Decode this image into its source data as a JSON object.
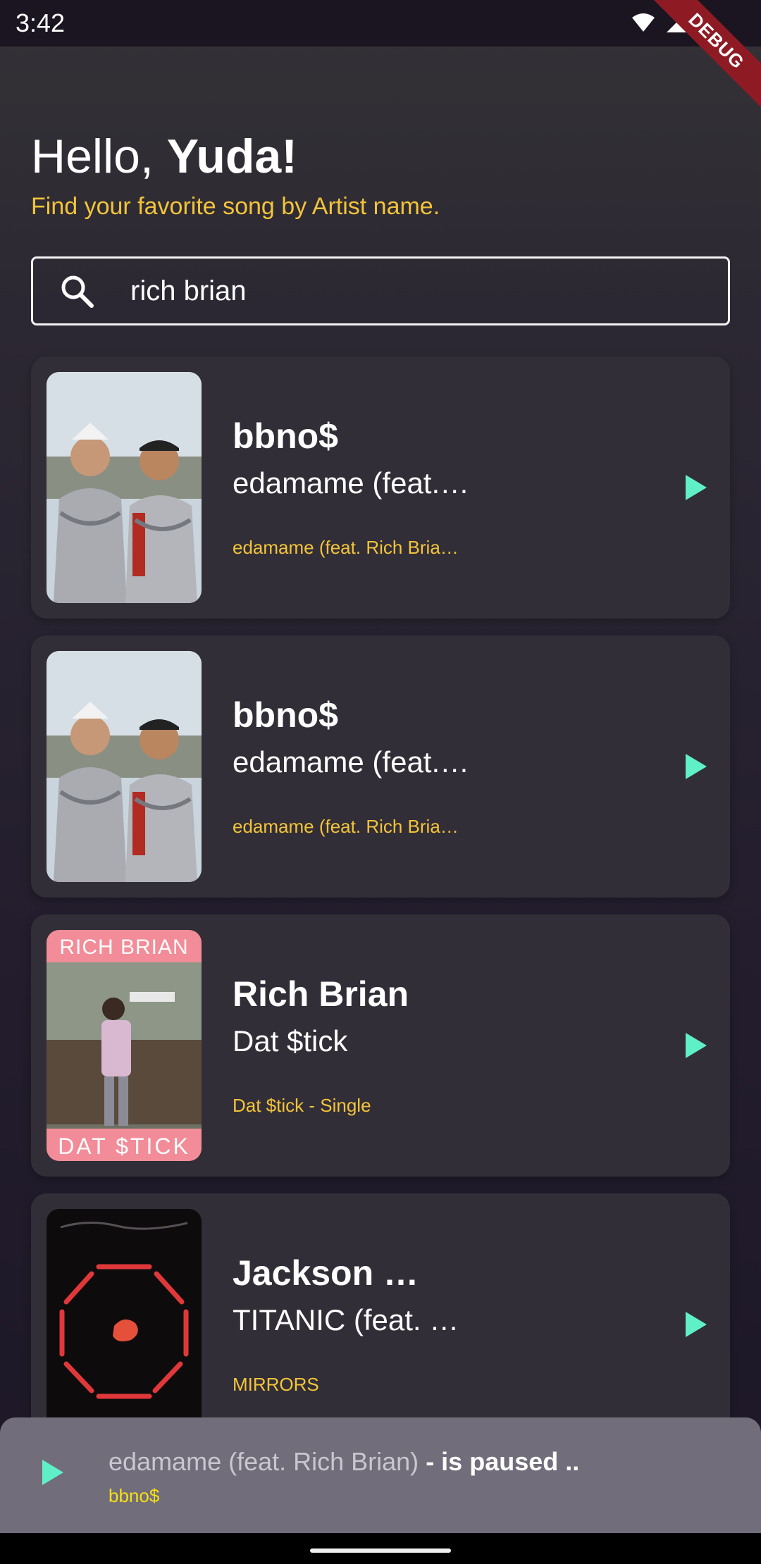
{
  "status_bar": {
    "time": "3:42",
    "icons": [
      "wifi-icon",
      "cell-signal-icon",
      "battery-icon"
    ],
    "debug_label": "DEBUG"
  },
  "header": {
    "greeting_prefix": "Hello, ",
    "user_name": "Yuda!",
    "subtitle": "Find your favorite song by Artist name."
  },
  "search": {
    "value": "rich brian",
    "icon": "search-icon"
  },
  "songs": [
    {
      "artist": "bbno$",
      "track": "edamame (feat.…",
      "album": "edamame (feat. Rich Bria…",
      "cover": "cover-armor"
    },
    {
      "artist": "bbno$",
      "track": "edamame (feat.…",
      "album": "edamame (feat. Rich Bria…",
      "cover": "cover-armor"
    },
    {
      "artist": "Rich Brian",
      "track": "Dat $tick",
      "album": "Dat $tick - Single",
      "cover": "cover-dat-stick"
    },
    {
      "artist": "Jackson …",
      "track": "TITANIC (feat. …",
      "album": "MIRRORS",
      "cover": "cover-mirrors"
    }
  ],
  "mini_player": {
    "track": "edamame (feat. Rich Brian)",
    "status": " - is paused ..",
    "artist": "bbno$",
    "icon": "play-icon"
  },
  "colors": {
    "accent_yellow": "#f3c43a",
    "play_green": "#5ff0c8",
    "card_bg": "#322e37",
    "mini_player_bg": "#726d7a",
    "mini_artist": "#f3e016"
  }
}
